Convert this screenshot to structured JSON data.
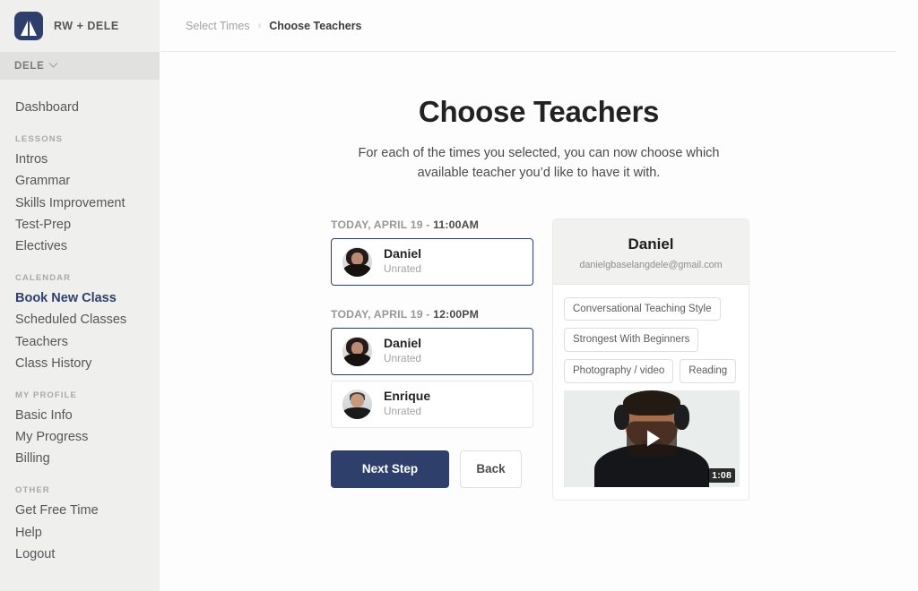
{
  "sidebar": {
    "brand": {
      "logo_icon": "sail-logo-icon",
      "name": "RW + DELE"
    },
    "org": {
      "name": "DELE",
      "caret_icon": "chevron-down-icon"
    },
    "primary": [
      {
        "label": "Dashboard",
        "active": false
      }
    ],
    "groups": [
      {
        "label": "LESSONS",
        "items": [
          {
            "label": "Intros",
            "active": false
          },
          {
            "label": "Grammar",
            "active": false
          },
          {
            "label": "Skills Improvement",
            "active": false
          },
          {
            "label": "Test-Prep",
            "active": false
          },
          {
            "label": "Electives",
            "active": false
          }
        ]
      },
      {
        "label": "CALENDAR",
        "items": [
          {
            "label": "Book New Class",
            "active": true
          },
          {
            "label": "Scheduled Classes",
            "active": false
          },
          {
            "label": "Teachers",
            "active": false
          },
          {
            "label": "Class History",
            "active": false
          }
        ]
      },
      {
        "label": "MY PROFILE",
        "items": [
          {
            "label": "Basic Info",
            "active": false
          },
          {
            "label": "My Progress",
            "active": false
          },
          {
            "label": "Billing",
            "active": false
          }
        ]
      },
      {
        "label": "OTHER",
        "items": [
          {
            "label": "Get Free Time",
            "active": false
          },
          {
            "label": "Help",
            "active": false
          },
          {
            "label": "Logout",
            "active": false
          }
        ]
      }
    ]
  },
  "breadcrumb": {
    "previous": "Select Times",
    "separator": "›",
    "current": "Choose Teachers"
  },
  "page": {
    "title": "Choose Teachers",
    "subtitle": "For each of the times you selected, you can now choose which available teacher you’d like to have it with."
  },
  "slots": [
    {
      "date_label": "TODAY, APRIL 19 - ",
      "time_label": "11:00AM",
      "teachers": [
        {
          "name": "Daniel",
          "rating": "Unrated",
          "avatar": "a-daniel",
          "selected": true
        }
      ]
    },
    {
      "date_label": "TODAY, APRIL 19 - ",
      "time_label": "12:00PM",
      "teachers": [
        {
          "name": "Daniel",
          "rating": "Unrated",
          "avatar": "a-daniel",
          "selected": true
        },
        {
          "name": "Enrique",
          "rating": "Unrated",
          "avatar": "a-enrique",
          "selected": false
        }
      ]
    }
  ],
  "actions": {
    "primary_label": "Next Step",
    "secondary_label": "Back"
  },
  "teacher_panel": {
    "name": "Daniel",
    "email": "danielgbaselangdele@gmail.com",
    "tags": [
      "Conversational Teaching Style",
      "Strongest With Beginners",
      "Photography / video",
      "Reading"
    ],
    "video": {
      "play_icon": "play-icon",
      "duration": "1:08"
    }
  },
  "colors": {
    "brand_navy": "#2f3f6b",
    "sidebar_bg": "#efefed",
    "org_row_bg": "#e1e1e0",
    "muted_text": "#a3a3a1",
    "panel_head_bg": "#f1f1ef"
  }
}
